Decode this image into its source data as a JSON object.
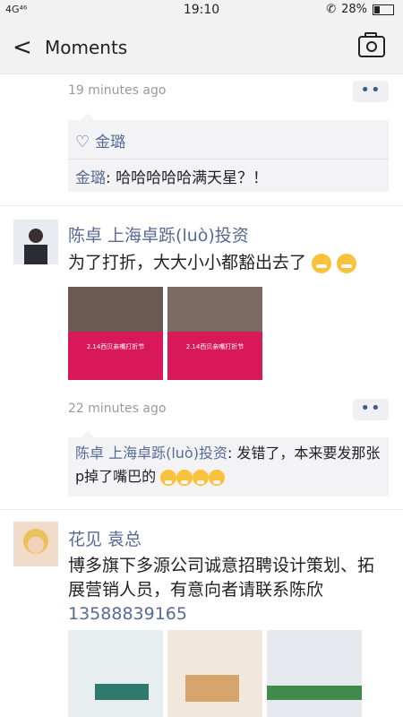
{
  "status_bar": {
    "network": "4G⁴⁶",
    "time": "19:10",
    "battery": "28%"
  },
  "header": {
    "title": "Moments"
  },
  "posts": [
    {
      "time": "19 minutes ago",
      "likes": "金璐",
      "comments": [
        {
          "name": "金璐",
          "text": ": 哈哈哈哈哈满天星？！"
        }
      ]
    },
    {
      "name": "陈卓 上海卓跞(luò)投资",
      "text": "为了打折，大大小小都豁出去了",
      "image_banner": "2.14西贝亲嘴打折节",
      "time": "22 minutes ago",
      "comments": [
        {
          "name": "陈卓 上海卓跞(luò)投资",
          "text": ": 发错了，本来要发那张p掉了嘴巴的"
        }
      ]
    },
    {
      "name": "花见  袁总",
      "text": "博多旗下多源公司诚意招聘设计策划、拓展营销人员，有意向者请联系陈欣",
      "phone": "13588839165"
    }
  ]
}
